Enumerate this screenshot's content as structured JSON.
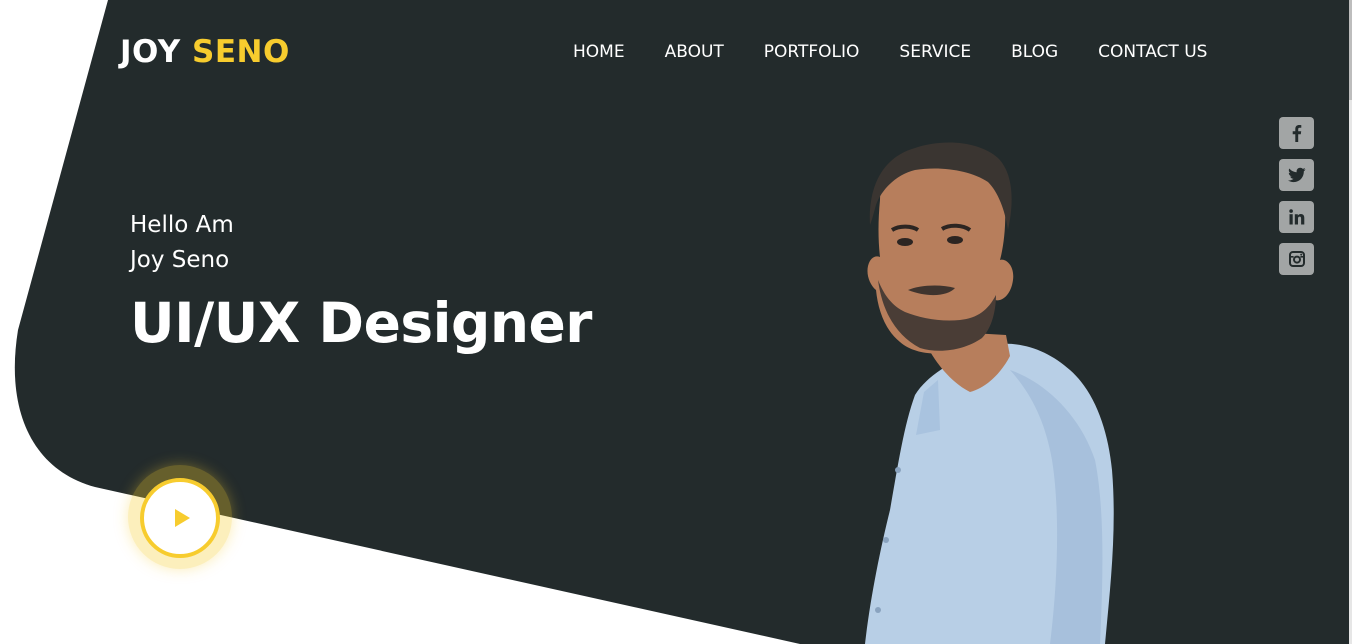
{
  "brand": {
    "first": "JOY",
    "second": "SENO"
  },
  "nav": {
    "items": [
      "HOME",
      "ABOUT",
      "PORTFOLIO",
      "SERVICE",
      "BLOG",
      "CONTACT US"
    ]
  },
  "social": {
    "icons": [
      "facebook-icon",
      "twitter-icon",
      "linkedin-icon",
      "instagram-icon"
    ],
    "glyphs": [
      "f",
      "t",
      "in",
      "ig"
    ]
  },
  "hero": {
    "greeting_line1": "Hello Am",
    "greeting_line2": "Joy Seno",
    "headline": "UI/UX Designer"
  },
  "colors": {
    "background_dark": "#232b2c",
    "accent": "#f7cc2e",
    "text": "#ffffff",
    "social_button": "#a2a5a5",
    "shirt": "#b8cfe6",
    "skin": "#b77e5c"
  }
}
